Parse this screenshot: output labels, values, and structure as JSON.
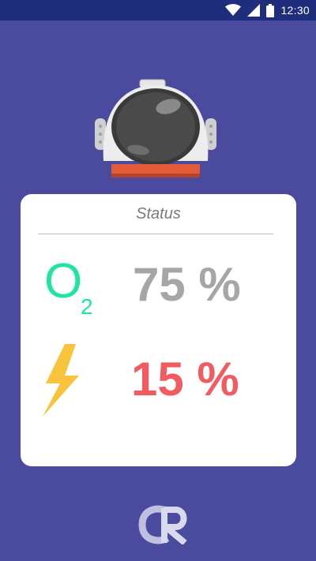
{
  "status_bar": {
    "time": "12:30",
    "icons": [
      "wifi-icon",
      "cellular-signal-icon",
      "battery-icon"
    ]
  },
  "status_card": {
    "title": "Status",
    "oxygen": {
      "symbol": "O",
      "subscript": "2",
      "value": "75 %",
      "color": "#A6A6A6",
      "icon_color": "#1EE6A0"
    },
    "energy": {
      "icon": "lightning-bolt-icon",
      "value": "15 %",
      "color": "#F25B5F",
      "icon_color": "#F9C33B"
    }
  },
  "colors": {
    "background": "#4A4A9E",
    "status_bar": "#1E2E7C",
    "card": "#FFFFFF",
    "helmet_collar": "#E25C3A"
  },
  "logo": {
    "icon": "cr-logo-icon"
  }
}
